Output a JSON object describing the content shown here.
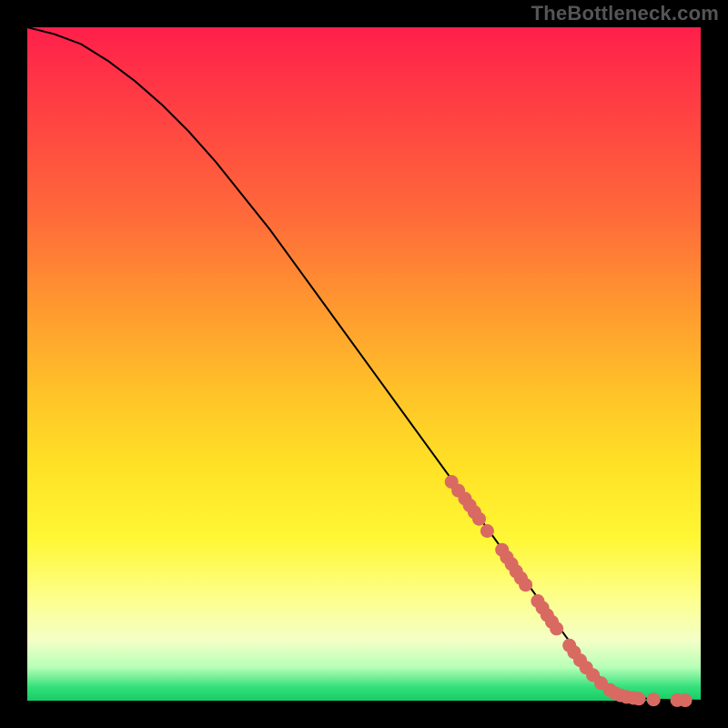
{
  "watermark": "TheBottleneck.com",
  "chart_data": {
    "type": "line",
    "title": "",
    "xlabel": "",
    "ylabel": "",
    "xlim": [
      0,
      100
    ],
    "ylim": [
      0,
      100
    ],
    "series": [
      {
        "name": "curve",
        "x": [
          0,
          4,
          8,
          12,
          16,
          20,
          24,
          28,
          32,
          36,
          40,
          44,
          48,
          52,
          56,
          60,
          64,
          68,
          72,
          76,
          80,
          82,
          84,
          86,
          88,
          90,
          92,
          94,
          96,
          98,
          100
        ],
        "y": [
          100,
          99,
          97.5,
          95,
          92,
          88.5,
          84.5,
          80,
          75,
          70,
          64.5,
          59,
          53.5,
          48,
          42.5,
          37,
          31.5,
          26,
          20.5,
          15,
          9.5,
          7,
          4.5,
          2.5,
          1.2,
          0.6,
          0.3,
          0.15,
          0.08,
          0.04,
          0.02
        ]
      }
    ],
    "highlight_points": [
      {
        "x": 63,
        "y": 32.5
      },
      {
        "x": 64,
        "y": 31.2
      },
      {
        "x": 65,
        "y": 30
      },
      {
        "x": 65.7,
        "y": 29
      },
      {
        "x": 66.4,
        "y": 28
      },
      {
        "x": 67.1,
        "y": 27
      },
      {
        "x": 68.3,
        "y": 25.2
      },
      {
        "x": 70.5,
        "y": 22.4
      },
      {
        "x": 71.2,
        "y": 21.3
      },
      {
        "x": 71.9,
        "y": 20.3
      },
      {
        "x": 72.6,
        "y": 19.2
      },
      {
        "x": 73.3,
        "y": 18.2
      },
      {
        "x": 74,
        "y": 17.2
      },
      {
        "x": 75.8,
        "y": 14.8
      },
      {
        "x": 76.5,
        "y": 13.8
      },
      {
        "x": 77.2,
        "y": 12.7
      },
      {
        "x": 77.9,
        "y": 11.7
      },
      {
        "x": 78.6,
        "y": 10.7
      },
      {
        "x": 80.5,
        "y": 8.2
      },
      {
        "x": 81.2,
        "y": 7.2
      },
      {
        "x": 82.1,
        "y": 6
      },
      {
        "x": 83,
        "y": 4.9
      },
      {
        "x": 84,
        "y": 3.8
      },
      {
        "x": 85.2,
        "y": 2.6
      },
      {
        "x": 86.5,
        "y": 1.6
      },
      {
        "x": 87.3,
        "y": 1.1
      },
      {
        "x": 88.1,
        "y": 0.8
      },
      {
        "x": 89,
        "y": 0.55
      },
      {
        "x": 90,
        "y": 0.4
      },
      {
        "x": 90.8,
        "y": 0.3
      },
      {
        "x": 93,
        "y": 0.18
      },
      {
        "x": 96.5,
        "y": 0.08
      },
      {
        "x": 97.7,
        "y": 0.06
      }
    ],
    "gradient_stops": [
      {
        "pos": 0,
        "color": "#ff1f4b"
      },
      {
        "pos": 10,
        "color": "#ff3a44"
      },
      {
        "pos": 28,
        "color": "#ff6a3a"
      },
      {
        "pos": 42,
        "color": "#ff9a2f"
      },
      {
        "pos": 55,
        "color": "#ffc528"
      },
      {
        "pos": 66,
        "color": "#ffe326"
      },
      {
        "pos": 76,
        "color": "#fff735"
      },
      {
        "pos": 85,
        "color": "#fdff8e"
      },
      {
        "pos": 91,
        "color": "#f4ffc6"
      },
      {
        "pos": 95,
        "color": "#b8ffb8"
      },
      {
        "pos": 98,
        "color": "#33e07a"
      },
      {
        "pos": 100,
        "color": "#17cc66"
      }
    ],
    "dot_color": "#d86a62",
    "line_color": "#000000"
  }
}
